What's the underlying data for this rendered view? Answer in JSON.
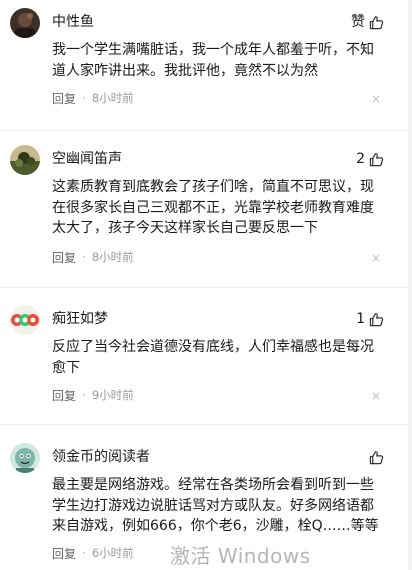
{
  "comments": [
    {
      "username": "中性鱼",
      "like_label": "赞",
      "text": "我一个学生满嘴脏话，我一个成年人都羞于听，不知\n道人家咋讲出来。我批评他，竟然不以为然",
      "reply_label": "回复",
      "dot": "·",
      "time": "8小时前",
      "avatar": "avatar-photo-dark"
    },
    {
      "username": "空幽闻笛声",
      "like_label": "2",
      "text": "这素质教育到底教会了孩子们啥，简直不可思议，现\n在很多家长自己三观都不正，光靠学校老师教育难度\n太大了，孩子今天这样家长自己要反思一下",
      "reply_label": "回复",
      "dot": "·",
      "time": "8小时前",
      "avatar": "avatar-photo-landscape"
    },
    {
      "username": "痴狂如梦",
      "like_label": "1",
      "text": "反应了当今社会道德没有底线，人们幸福感也是每况\n愈下",
      "reply_label": "回复",
      "dot": "·",
      "time": "9小时前",
      "avatar": "avatar-colorful-dots"
    },
    {
      "username": "领金币的阅读者",
      "like_label": "",
      "text": "最主要是网络游戏。经常在各类场所会看到听到一些\n学生边打游戏边说脏话骂对方或队友。好多网络语都\n来自游戏，例如666，你个老6，沙雕，栓Q……等等",
      "reply_label": "回复",
      "dot": "·",
      "time": "6小时前",
      "avatar": "avatar-cartoon-character"
    }
  ],
  "close_glyph": "×",
  "watermark": "激活 Windows",
  "colors": {
    "text": "#1a1a1a",
    "meta": "#8a8a8a",
    "divider": "#ececec"
  }
}
